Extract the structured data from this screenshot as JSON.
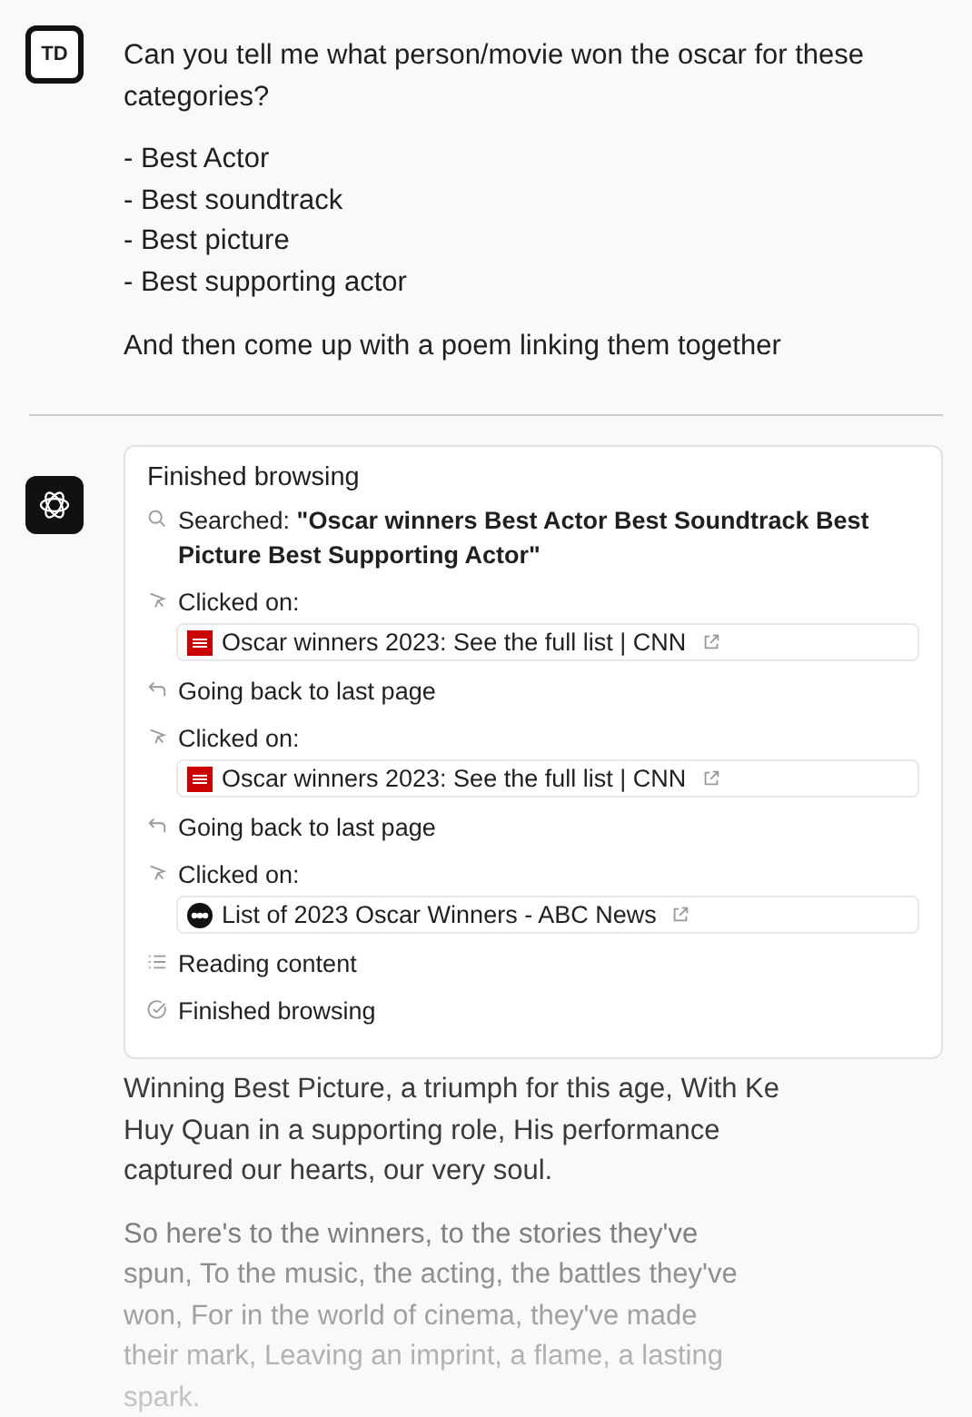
{
  "user": {
    "avatar": "TD",
    "paragraphs": [
      "Can you tell me what person/movie won the oscar for these categories?"
    ],
    "list": [
      "- Best Actor",
      "- Best soundtrack",
      "- Best picture",
      "- Best supporting actor"
    ],
    "closing": "And then come up with a poem linking them together"
  },
  "browsing": {
    "title": "Finished browsing",
    "steps": [
      {
        "kind": "search",
        "text": "Searched: **\"Oscar winners Best Actor Best Soundtrack Best Picture Best Supporting Actor\"**"
      },
      {
        "kind": "click",
        "text": "Clicked on:",
        "link": {
          "kind": "cnn",
          "title": "Oscar winners 2023: See the full list | CNN"
        }
      },
      {
        "kind": "back",
        "text": "Going back to last page"
      },
      {
        "kind": "click",
        "text": "Clicked on:",
        "link": {
          "kind": "cnn",
          "title": "Oscar winners 2023: See the full list | CNN"
        }
      },
      {
        "kind": "back",
        "text": "Going back to last page"
      },
      {
        "kind": "click",
        "text": "Clicked on:",
        "link": {
          "kind": "abc",
          "title": "List of 2023 Oscar Winners - ABC News"
        }
      },
      {
        "kind": "reading",
        "text": "Reading content"
      },
      {
        "kind": "done",
        "text": "Finished browsing"
      }
    ]
  },
  "poem": [
    "Winning Best Picture, a triumph for this age, With Ke Huy Quan in a supporting role, His performance captured our hearts, our very soul.",
    "So here's to the winners, to the stories they've spun, To the music, the acting, the battles they've won, For in the world of cinema, they've made their mark, Leaving an imprint, a flame, a lasting spark."
  ]
}
